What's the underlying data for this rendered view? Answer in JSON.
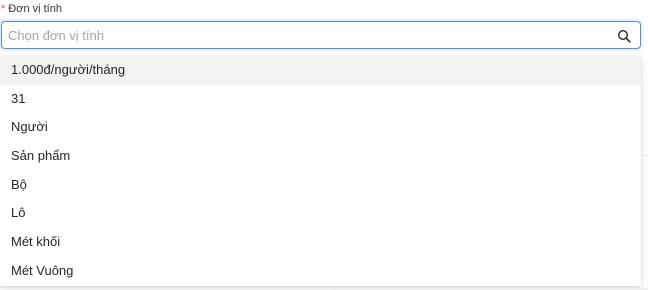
{
  "field": {
    "required_mark": "*",
    "label": "Đơn vị tính",
    "placeholder": "Chọn đơn vị tính",
    "search_icon": "search-icon"
  },
  "dropdown": {
    "options": [
      {
        "label": "1.000đ/người/tháng",
        "active": true
      },
      {
        "label": "31",
        "active": false
      },
      {
        "label": "Người",
        "active": false
      },
      {
        "label": "Sản phẩm",
        "active": false
      },
      {
        "label": "Bộ",
        "active": false
      },
      {
        "label": "Lô",
        "active": false
      },
      {
        "label": "Mét khối",
        "active": false
      },
      {
        "label": "Mét Vuông",
        "active": false
      }
    ]
  },
  "colors": {
    "focus_border": "#4f8ef7",
    "required": "#ff4d4f",
    "active_option_bg": "#f2f2f2"
  }
}
